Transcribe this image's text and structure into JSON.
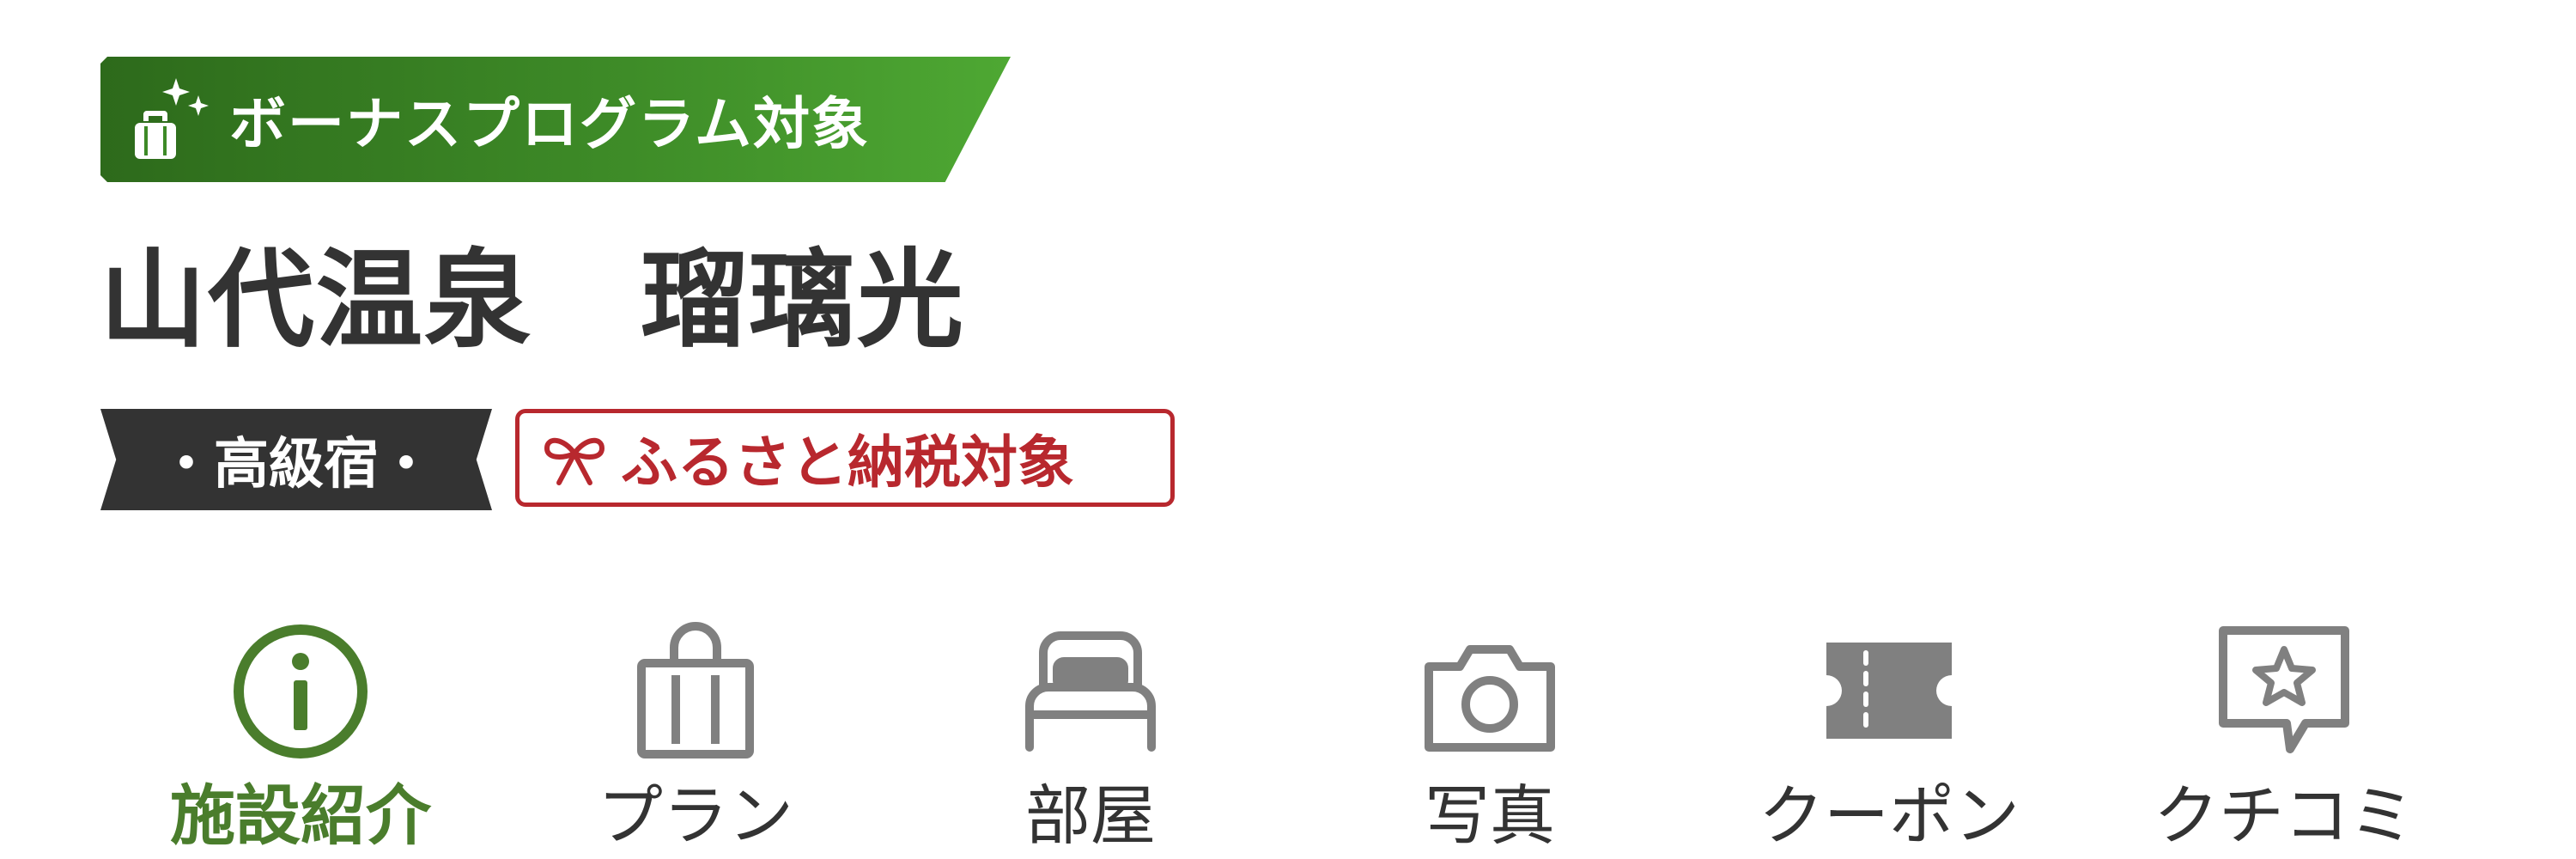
{
  "banner": {
    "text": "ボーナスプログラム対象",
    "icon": "suitcase-sparkle-icon",
    "color_start": "#2d6a1b",
    "color_end": "#4ea833"
  },
  "hotel": {
    "name": "山代温泉　瑠璃光"
  },
  "badges": {
    "luxury": "・高級宿・",
    "furusato": "ふるさと納税対象",
    "furusato_icon": "ribbon-icon",
    "furusato_color": "#b8282e"
  },
  "nav": {
    "active_color": "#4a7d2c",
    "items": [
      {
        "label": "施設紹介",
        "icon": "info-icon",
        "active": true
      },
      {
        "label": "プラン",
        "icon": "shopping-bag-icon",
        "active": false
      },
      {
        "label": "部屋",
        "icon": "bed-icon",
        "active": false
      },
      {
        "label": "写真",
        "icon": "camera-icon",
        "active": false
      },
      {
        "label": "クーポン",
        "icon": "ticket-icon",
        "active": false
      },
      {
        "label": "クチコミ",
        "icon": "review-star-icon",
        "active": false
      }
    ]
  }
}
